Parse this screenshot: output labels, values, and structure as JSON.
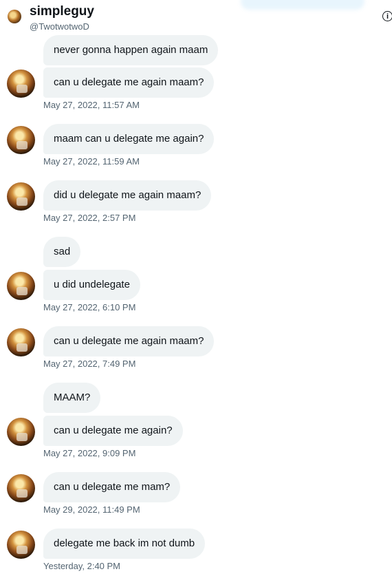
{
  "header": {
    "name": "simpleguy",
    "handle": "@TwotwotwoD",
    "info_glyph": "i"
  },
  "messages": [
    {
      "text": "never gonna happen again maam"
    },
    {
      "text": "can u delegate me again maam?",
      "timestamp": "May 27, 2022, 11:57 AM"
    },
    {
      "text": "maam can u delegate me again?",
      "timestamp": "May 27, 2022, 11:59 AM"
    },
    {
      "text": "did u delegate me again maam?",
      "timestamp": "May 27, 2022, 2:57 PM"
    },
    {
      "text": "sad"
    },
    {
      "text": "u did undelegate",
      "timestamp": "May 27, 2022, 6:10 PM"
    },
    {
      "text": "can u delegate me again maam?",
      "timestamp": "May 27, 2022, 7:49 PM"
    },
    {
      "text": "MAAM?"
    },
    {
      "text": "can u delegate me again?",
      "timestamp": "May 27, 2022, 9:09 PM"
    },
    {
      "text": "can u delegate me mam?",
      "timestamp": "May 29, 2022, 11:49 PM"
    },
    {
      "text": "delegate me back im not dumb",
      "timestamp": "Yesterday, 2:40 PM"
    }
  ]
}
